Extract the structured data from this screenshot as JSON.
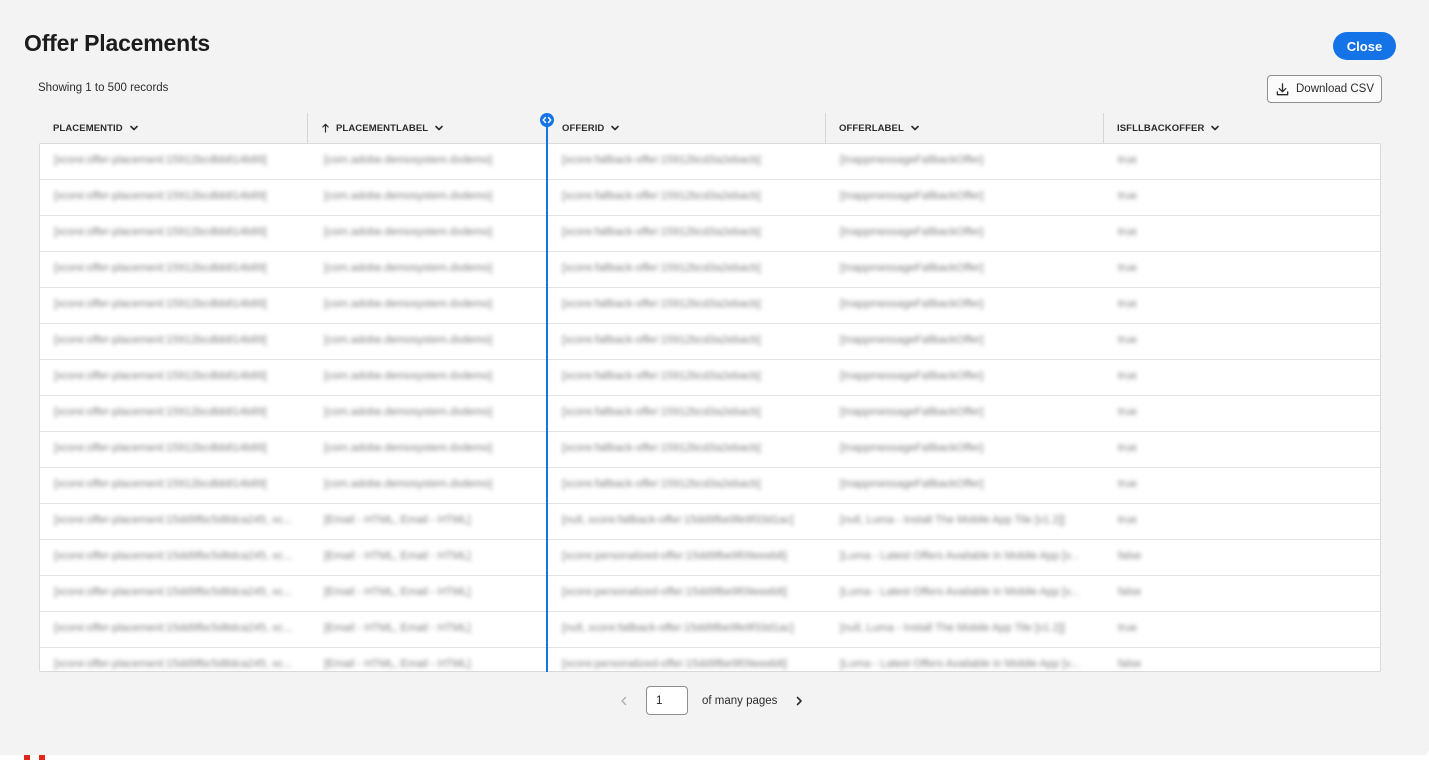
{
  "dialog": {
    "title": "Offer Placements",
    "close_label": "Close",
    "records_text": "Showing 1 to 500 records",
    "download_label": "Download CSV"
  },
  "columns": [
    {
      "label": "PLACEMENTID",
      "sorted": false
    },
    {
      "label": "PLACEMENTLABEL",
      "sorted": true
    },
    {
      "label": "OFFERID",
      "sorted": false
    },
    {
      "label": "OFFERLABEL",
      "sorted": false
    },
    {
      "label": "ISFLLBACKOFFER",
      "sorted": false
    }
  ],
  "rows": [
    [
      "[xcore:offer-placement:15912bcdbb814b89]",
      "[com.adobe.demosystem.dxdemo]",
      "[xcore:fallback-offer:15912bcd3a2ebacb]",
      "[InappmessageFallbackOffer]",
      "true"
    ],
    [
      "[xcore:offer-placement:15912bcdbb814b89]",
      "[com.adobe.demosystem.dxdemo]",
      "[xcore:fallback-offer:15912bcd3a2ebacb]",
      "[InappmessageFallbackOffer]",
      "true"
    ],
    [
      "[xcore:offer-placement:15912bcdbb814b89]",
      "[com.adobe.demosystem.dxdemo]",
      "[xcore:fallback-offer:15912bcd3a2ebacb]",
      "[InappmessageFallbackOffer]",
      "true"
    ],
    [
      "[xcore:offer-placement:15912bcdbb814b89]",
      "[com.adobe.demosystem.dxdemo]",
      "[xcore:fallback-offer:15912bcd3a2ebacb]",
      "[InappmessageFallbackOffer]",
      "true"
    ],
    [
      "[xcore:offer-placement:15912bcdbb814b89]",
      "[com.adobe.demosystem.dxdemo]",
      "[xcore:fallback-offer:15912bcd3a2ebacb]",
      "[InappmessageFallbackOffer]",
      "true"
    ],
    [
      "[xcore:offer-placement:15912bcdbb814b89]",
      "[com.adobe.demosystem.dxdemo]",
      "[xcore:fallback-offer:15912bcd3a2ebacb]",
      "[InappmessageFallbackOffer]",
      "true"
    ],
    [
      "[xcore:offer-placement:15912bcdbb814b89]",
      "[com.adobe.demosystem.dxdemo]",
      "[xcore:fallback-offer:15912bcd3a2ebacb]",
      "[InappmessageFallbackOffer]",
      "true"
    ],
    [
      "[xcore:offer-placement:15912bcdbb814b89]",
      "[com.adobe.demosystem.dxdemo]",
      "[xcore:fallback-offer:15912bcd3a2ebacb]",
      "[InappmessageFallbackOffer]",
      "true"
    ],
    [
      "[xcore:offer-placement:15912bcdbb814b89]",
      "[com.adobe.demosystem.dxdemo]",
      "[xcore:fallback-offer:15912bcd3a2ebacb]",
      "[InappmessageFallbackOffer]",
      "true"
    ],
    [
      "[xcore:offer-placement:15912bcdbb814b89]",
      "[com.adobe.demosystem.dxdemo]",
      "[xcore:fallback-offer:15912bcd3a2ebacb]",
      "[InappmessageFallbackOffer]",
      "true"
    ],
    [
      "[xcore:offer-placement:15dd9fbc5d8dca245, xc...",
      "[Email - HTML, Email - HTML]",
      "[null, xcore:fallback-offer:15dd9fbe9fe9f33d1ac]",
      "[null, Luma - Install The Mobile App Tile [v1.2]]",
      "true"
    ],
    [
      "[xcore:offer-placement:15dd9fbc5d8dca245, xc...",
      "[Email - HTML, Email - HTML]",
      "[xcore:personalized-offer:15dd9fbe9f09eeeb8]",
      "[Luma - Latest Offers Available in Mobile App [v...",
      "false"
    ],
    [
      "[xcore:offer-placement:15dd9fbc5d8dca245, xc...",
      "[Email - HTML, Email - HTML]",
      "[xcore:personalized-offer:15dd9fbe9f09eeeb8]",
      "[Luma - Latest Offers Available in Mobile App [v...",
      "false"
    ],
    [
      "[xcore:offer-placement:15dd9fbc5d8dca245, xc...",
      "[Email - HTML, Email - HTML]",
      "[null, xcore:fallback-offer:15dd9fbe9fe9f33d1ac]",
      "[null, Luma - Install The Mobile App Tile [v1.2]]",
      "true"
    ],
    [
      "[xcore:offer-placement:15dd9fbc5d8dca245, xc...",
      "[Email - HTML, Email - HTML]",
      "[xcore:personalized-offer:15dd9fbe9f09eeeb8]",
      "[Luma - Latest Offers Available in Mobile App [v...",
      "false"
    ]
  ],
  "pagination": {
    "current_page": "1",
    "of_text": "of many pages"
  },
  "colors": {
    "accent": "#1473e6",
    "background": "#f3f3f3",
    "brand": "#e1251b"
  },
  "icons": {
    "download": "download-icon",
    "chevron": "chevron-down-icon",
    "sort": "sort-ascending-icon",
    "resize": "column-resize-handle-icon",
    "prev": "chevron-left-icon",
    "next": "chevron-right-icon"
  }
}
